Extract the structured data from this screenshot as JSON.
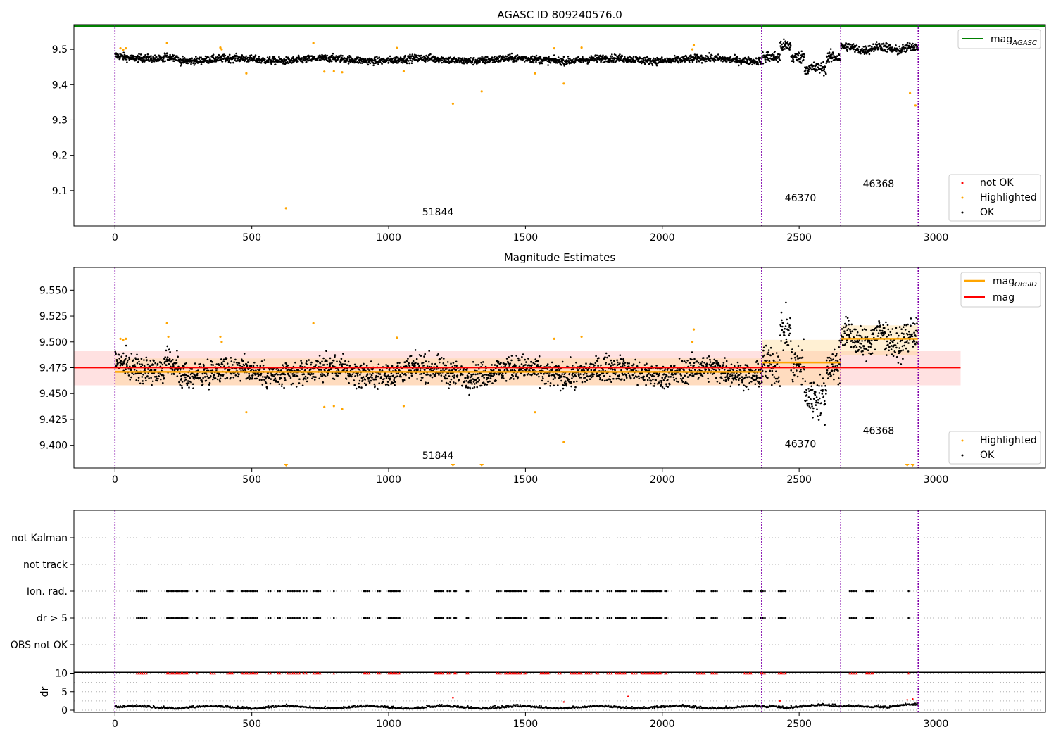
{
  "chart_data": [
    {
      "type": "scatter",
      "title": "AGASC ID 809240576.0",
      "xlabel": "",
      "ylabel": "",
      "xlim": [
        -150,
        3400
      ],
      "ylim": [
        9.0,
        9.57
      ],
      "xticks": [
        0,
        500,
        1000,
        1500,
        2000,
        2500,
        3000
      ],
      "yticks": [
        9.1,
        9.2,
        9.3,
        9.4,
        9.5
      ],
      "ytick_labels": [
        "9.1",
        "9.2",
        "9.3",
        "9.4",
        "9.5"
      ],
      "grid": false,
      "mag_agasc": 9.566,
      "obs_boundaries": [
        0,
        2363,
        2652,
        2935
      ],
      "obs_labels": [
        {
          "text": "51844",
          "x": 1180,
          "y": 9.03
        },
        {
          "text": "46370",
          "x": 2505,
          "y": 9.07
        },
        {
          "text": "46368",
          "x": 2790,
          "y": 9.11
        }
      ],
      "segments": [
        {
          "x0": 0,
          "x1": 2363,
          "center": 9.471,
          "spread": 0.012
        },
        {
          "x0": 2363,
          "x1": 2652,
          "center": 9.48,
          "spread": 0.022
        },
        {
          "x0": 2652,
          "x1": 2935,
          "center": 9.503,
          "spread": 0.014
        }
      ],
      "highlighted": [
        [
          20,
          9.503
        ],
        [
          30,
          9.499
        ],
        [
          40,
          9.503
        ],
        [
          190,
          9.518
        ],
        [
          385,
          9.505
        ],
        [
          390,
          9.5
        ],
        [
          480,
          9.432
        ],
        [
          625,
          9.05
        ],
        [
          725,
          9.518
        ],
        [
          765,
          9.437
        ],
        [
          800,
          9.438
        ],
        [
          830,
          9.435
        ],
        [
          1030,
          9.504
        ],
        [
          1055,
          9.438
        ],
        [
          1235,
          9.346
        ],
        [
          1340,
          9.381
        ],
        [
          1535,
          9.432
        ],
        [
          1605,
          9.503
        ],
        [
          1640,
          9.403
        ],
        [
          1705,
          9.505
        ],
        [
          2110,
          9.5
        ],
        [
          2115,
          9.512
        ],
        [
          2905,
          9.376
        ],
        [
          2925,
          9.341
        ]
      ],
      "not_ok": [],
      "legend": {
        "location": "lower-right",
        "entries": [
          "not OK",
          "Highlighted",
          "OK"
        ]
      },
      "legend_top": {
        "location": "upper-right",
        "entries": [
          "mag"
        ],
        "subscripts": [
          "AGASC"
        ]
      }
    },
    {
      "type": "scatter",
      "title": "Magnitude Estimates",
      "xlabel": "",
      "ylabel": "",
      "xlim": [
        -150,
        3400
      ],
      "ylim": [
        9.378,
        9.572
      ],
      "xticks": [
        0,
        500,
        1000,
        1500,
        2000,
        2500,
        3000
      ],
      "yticks": [
        9.4,
        9.425,
        9.45,
        9.475,
        9.5,
        9.525,
        9.55
      ],
      "ytick_labels": [
        "9.400",
        "9.425",
        "9.450",
        "9.475",
        "9.500",
        "9.525",
        "9.550"
      ],
      "grid": false,
      "mag": 9.475,
      "mag_band": [
        9.458,
        9.491
      ],
      "mag_band_xrange": [
        -150,
        3090
      ],
      "obs_boundaries": [
        0,
        2363,
        2652,
        2935
      ],
      "obs_labels": [
        {
          "text": "51844",
          "x": 1180,
          "y": 9.387
        },
        {
          "text": "46370",
          "x": 2505,
          "y": 9.398
        },
        {
          "text": "46368",
          "x": 2790,
          "y": 9.411
        }
      ],
      "obsid_mags": [
        {
          "x0": 0,
          "x1": 2363,
          "mag": 9.471,
          "lo": 9.458,
          "hi": 9.484
        },
        {
          "x0": 2363,
          "x1": 2652,
          "mag": 9.48,
          "lo": 9.458,
          "hi": 9.502
        },
        {
          "x0": 2652,
          "x1": 2935,
          "mag": 9.503,
          "lo": 9.487,
          "hi": 9.516
        }
      ],
      "highlighted": [
        [
          20,
          9.503
        ],
        [
          30,
          9.502
        ],
        [
          40,
          9.503
        ],
        [
          190,
          9.518
        ],
        [
          195,
          9.505
        ],
        [
          385,
          9.505
        ],
        [
          390,
          9.5
        ],
        [
          480,
          9.432
        ],
        [
          725,
          9.518
        ],
        [
          765,
          9.437
        ],
        [
          800,
          9.438
        ],
        [
          830,
          9.435
        ],
        [
          1030,
          9.504
        ],
        [
          1055,
          9.438
        ],
        [
          1535,
          9.432
        ],
        [
          1605,
          9.503
        ],
        [
          1640,
          9.403
        ],
        [
          1705,
          9.505
        ],
        [
          2110,
          9.5
        ],
        [
          2115,
          9.512
        ]
      ],
      "below_range_markers": [
        625,
        1235,
        1340,
        2895,
        2915
      ],
      "legend": {
        "location": "lower-right",
        "entries": [
          "Highlighted",
          "OK"
        ]
      },
      "legend_top": {
        "location": "upper-right",
        "entries": [
          "mag",
          "mag"
        ],
        "subscripts": [
          "OBSID",
          ""
        ]
      }
    },
    {
      "type": "scatter",
      "title": "",
      "xlabel": "",
      "ylabel": "",
      "xlim": [
        -150,
        3400
      ],
      "xticks": [
        0,
        500,
        1000,
        1500,
        2000,
        2500,
        3000
      ],
      "flag_rows": [
        "not Kalman",
        "not track",
        "Ion. rad.",
        "dr > 5",
        "OBS not OK"
      ],
      "obs_boundaries": [
        0,
        2363,
        2652,
        2935
      ],
      "flag_clusters": [
        [
          80,
          20,
          4
        ],
        [
          100,
          15,
          3
        ],
        [
          190,
          75,
          14
        ],
        [
          300,
          5,
          1
        ],
        [
          350,
          15,
          3
        ],
        [
          410,
          20,
          4
        ],
        [
          465,
          55,
          10
        ],
        [
          560,
          8,
          2
        ],
        [
          595,
          8,
          2
        ],
        [
          630,
          45,
          8
        ],
        [
          690,
          10,
          2
        ],
        [
          725,
          25,
          5
        ],
        [
          800,
          5,
          1
        ],
        [
          910,
          20,
          4
        ],
        [
          960,
          8,
          2
        ],
        [
          1000,
          40,
          8
        ],
        [
          1170,
          30,
          6
        ],
        [
          1215,
          8,
          2
        ],
        [
          1240,
          6,
          2
        ],
        [
          1285,
          6,
          2
        ],
        [
          1395,
          15,
          3
        ],
        [
          1425,
          60,
          12
        ],
        [
          1495,
          6,
          2
        ],
        [
          1555,
          30,
          6
        ],
        [
          1620,
          8,
          2
        ],
        [
          1665,
          40,
          8
        ],
        [
          1720,
          20,
          4
        ],
        [
          1760,
          6,
          2
        ],
        [
          1800,
          15,
          3
        ],
        [
          1830,
          35,
          7
        ],
        [
          1890,
          15,
          3
        ],
        [
          1925,
          70,
          14
        ],
        [
          2010,
          6,
          2
        ],
        [
          2125,
          30,
          6
        ],
        [
          2180,
          20,
          4
        ],
        [
          2300,
          25,
          5
        ],
        [
          2360,
          15,
          3
        ],
        [
          2425,
          25,
          5
        ],
        [
          2685,
          25,
          5
        ],
        [
          2745,
          25,
          5
        ],
        [
          2900,
          6,
          1
        ]
      ],
      "dr": {
        "ylabel": "dr",
        "ylim": [
          0,
          10
        ],
        "yticks": [
          0,
          5,
          10
        ],
        "ytick_labels": [
          "0",
          "5",
          "10"
        ],
        "clipped_value": 10,
        "gridlines": [
          0,
          2.5,
          5,
          7.5,
          10
        ],
        "extra_points": [
          [
            1235,
            3.3
          ],
          [
            1640,
            2.2
          ],
          [
            1875,
            3.7
          ],
          [
            2895,
            2.8
          ],
          [
            2915,
            3.0
          ],
          [
            2430,
            2.5
          ]
        ]
      }
    }
  ]
}
